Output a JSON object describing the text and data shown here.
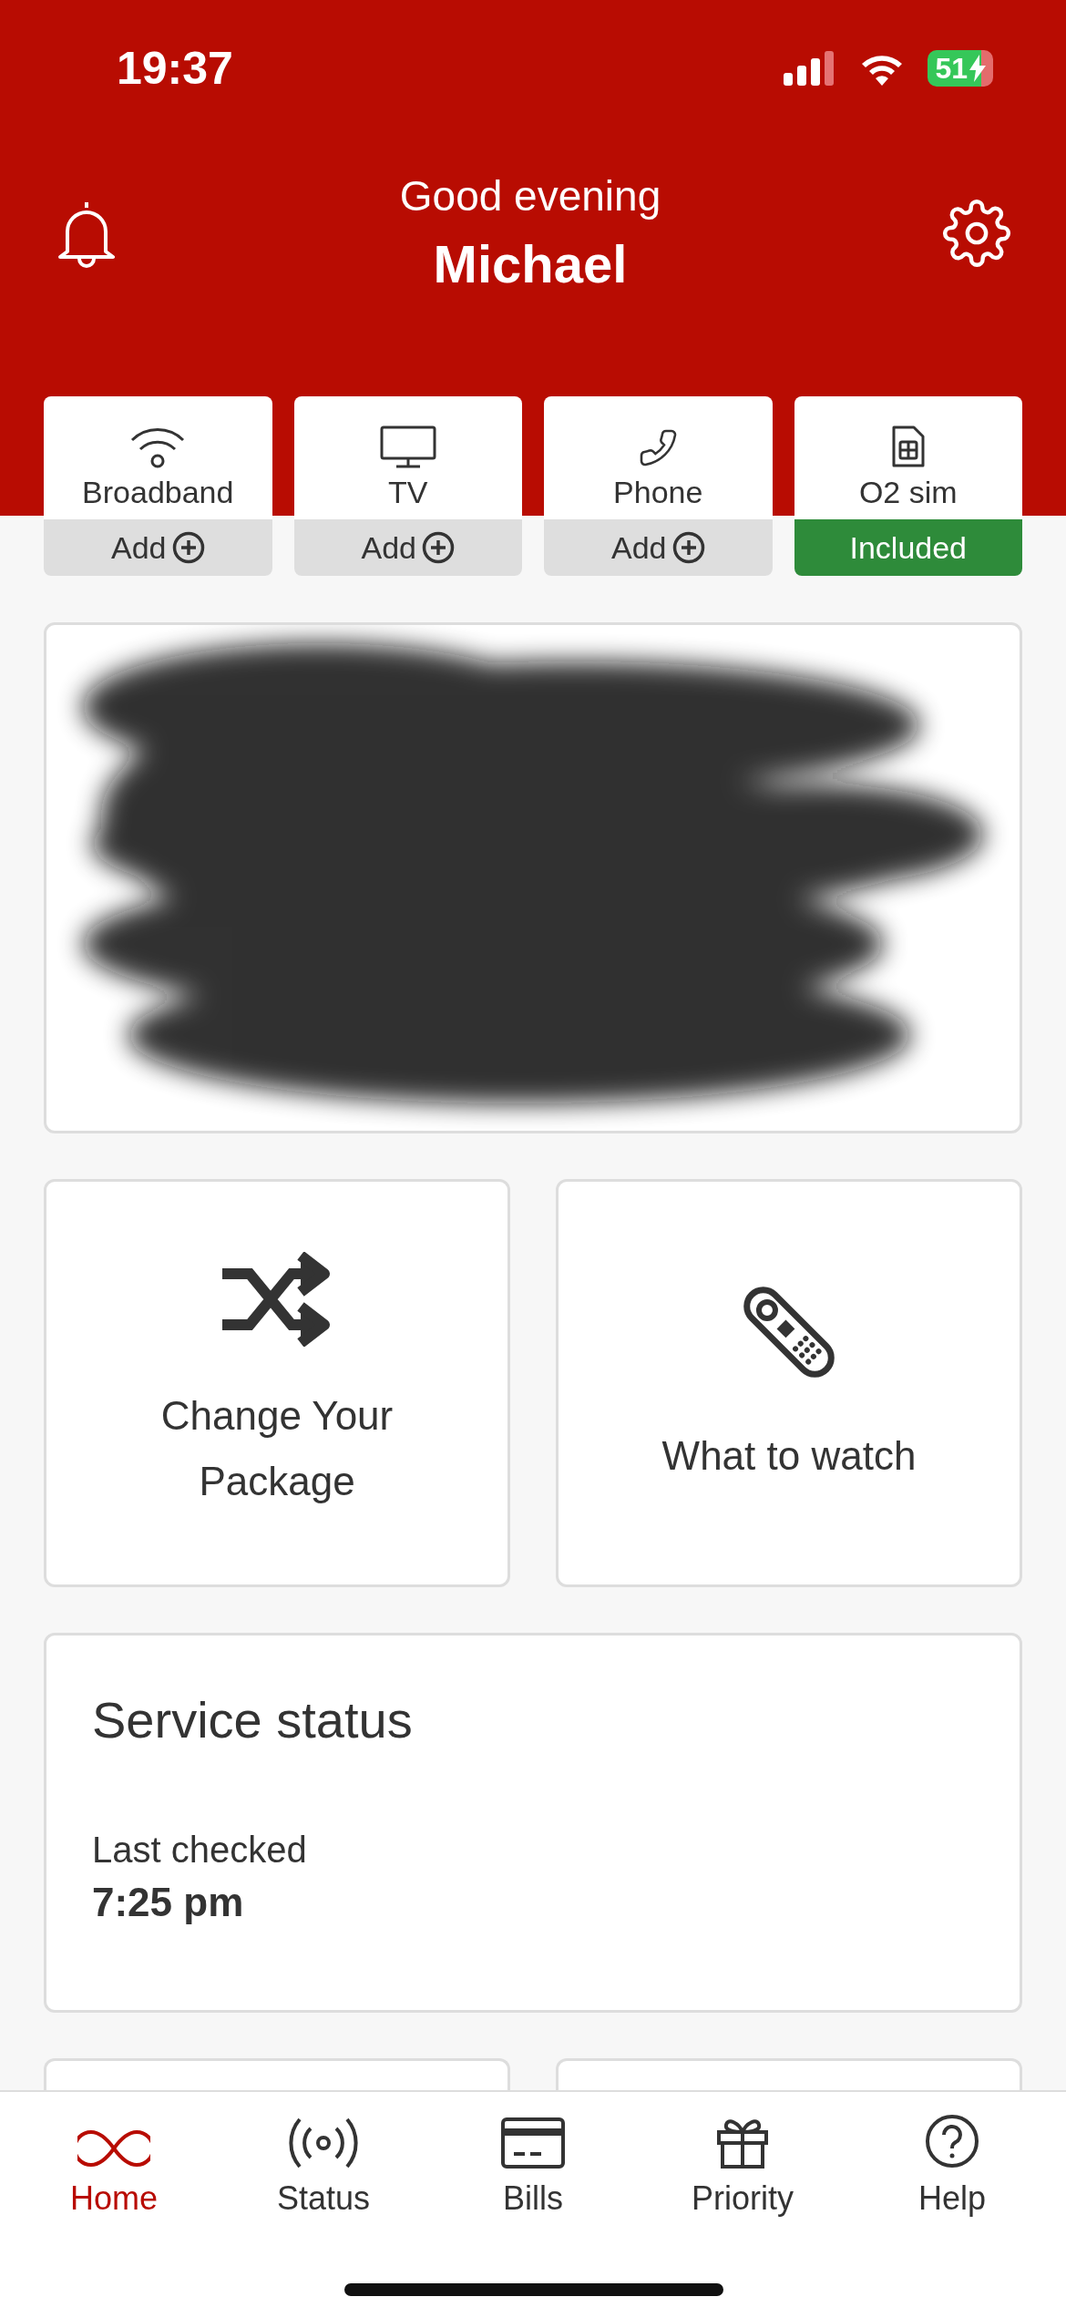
{
  "status_bar": {
    "time": "19:37",
    "battery": "51"
  },
  "header": {
    "greeting": "Good evening",
    "name": "Michael"
  },
  "services": [
    {
      "label": "Broadband",
      "action": "Add",
      "included": false
    },
    {
      "label": "TV",
      "action": "Add",
      "included": false
    },
    {
      "label": "Phone",
      "action": "Add",
      "included": false
    },
    {
      "label": "O2 sim",
      "action": "Included",
      "included": true
    }
  ],
  "bill_card": {
    "redacted": true
  },
  "shortcuts": [
    {
      "label": "Change Your Package"
    },
    {
      "label": "What to watch"
    }
  ],
  "service_status": {
    "title": "Service status",
    "checked_label": "Last checked",
    "checked_time": "7:25 pm"
  },
  "tabs": [
    {
      "label": "Home",
      "selected": true
    },
    {
      "label": "Status",
      "selected": false
    },
    {
      "label": "Bills",
      "selected": false
    },
    {
      "label": "Priority",
      "selected": false
    },
    {
      "label": "Help",
      "selected": false
    }
  ]
}
